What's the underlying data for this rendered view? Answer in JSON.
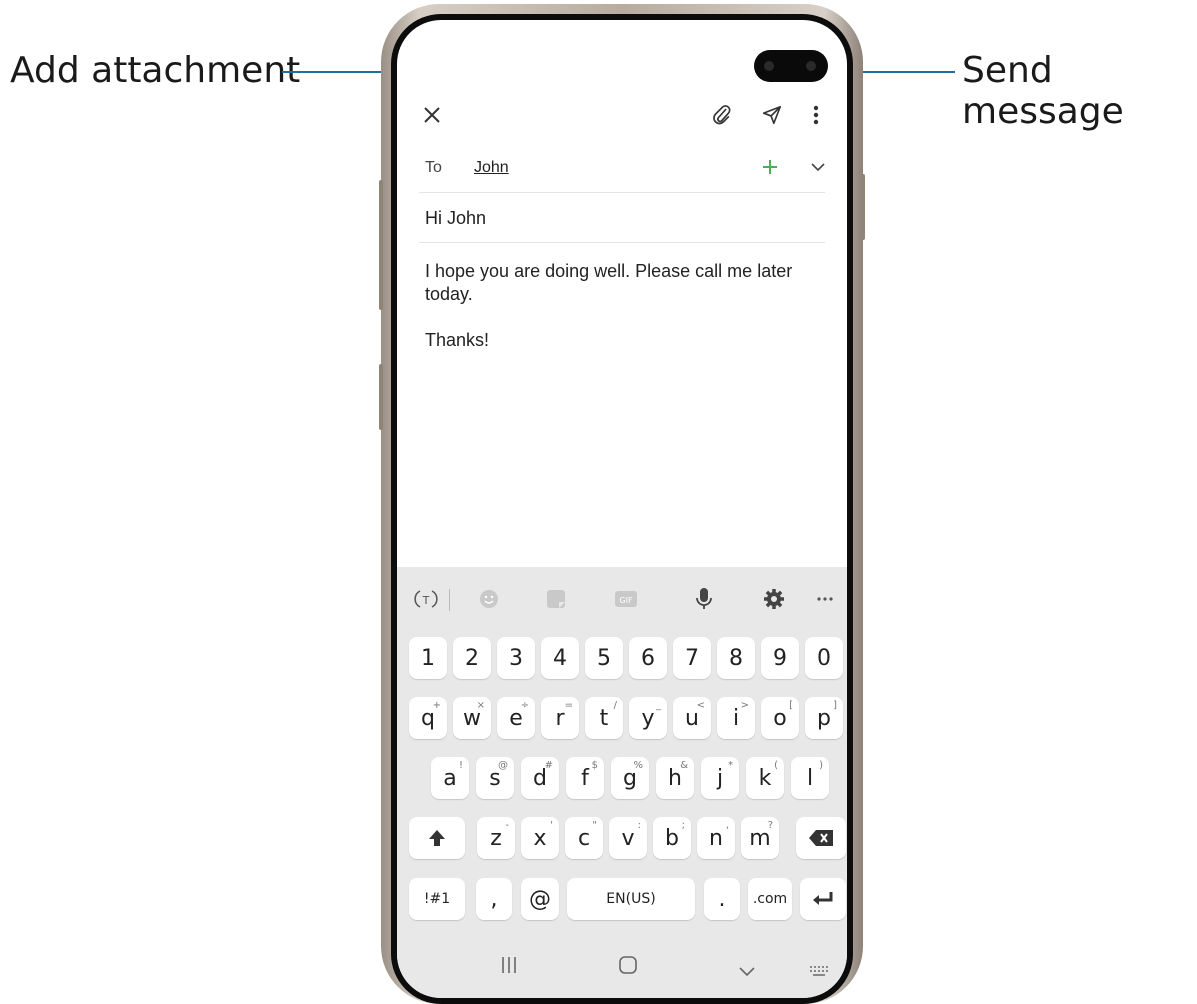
{
  "callouts": {
    "left_label": "Add attachment",
    "right_label": "Send message",
    "line_color": "#1f6fa0"
  },
  "app": {
    "to_label": "To",
    "recipient": "John",
    "subject": "Hi John",
    "body": "I hope you are doing well. Please call me later today.\n\nThanks!",
    "icons": {
      "close": "close-icon",
      "attach": "paperclip-icon",
      "send": "send-icon",
      "more": "more-vertical-icon",
      "add": "add-recipient-icon",
      "expand": "chevron-down-icon"
    },
    "add_color": "#4caf50"
  },
  "keyboard": {
    "toolbar": [
      "text-style-icon",
      "emoji-icon",
      "sticker-icon",
      "gif-icon",
      "microphone-icon",
      "settings-icon",
      "more-horizontal-icon"
    ],
    "numbers": [
      "1",
      "2",
      "3",
      "4",
      "5",
      "6",
      "7",
      "8",
      "9",
      "0"
    ],
    "row1": [
      {
        "k": "q",
        "s": "+"
      },
      {
        "k": "w",
        "s": "×"
      },
      {
        "k": "e",
        "s": "÷"
      },
      {
        "k": "r",
        "s": "="
      },
      {
        "k": "t",
        "s": "/"
      },
      {
        "k": "y",
        "s": "_"
      },
      {
        "k": "u",
        "s": "<"
      },
      {
        "k": "i",
        "s": ">"
      },
      {
        "k": "o",
        "s": "["
      },
      {
        "k": "p",
        "s": "]"
      }
    ],
    "row2": [
      {
        "k": "a",
        "s": "!"
      },
      {
        "k": "s",
        "s": "@"
      },
      {
        "k": "d",
        "s": "#"
      },
      {
        "k": "f",
        "s": "$"
      },
      {
        "k": "g",
        "s": "%"
      },
      {
        "k": "h",
        "s": "&"
      },
      {
        "k": "j",
        "s": "*"
      },
      {
        "k": "k",
        "s": "("
      },
      {
        "k": "l",
        "s": ")"
      }
    ],
    "row3": [
      {
        "k": "z",
        "s": "-"
      },
      {
        "k": "x",
        "s": "'"
      },
      {
        "k": "c",
        "s": "\""
      },
      {
        "k": "v",
        "s": ":"
      },
      {
        "k": "b",
        "s": ";"
      },
      {
        "k": "n",
        "s": ","
      },
      {
        "k": "m",
        "s": "?"
      }
    ],
    "sym_label": "!#1",
    "comma": ",",
    "at": "@",
    "space_label": "EN(US)",
    "period": ".",
    "dotcom": ".com",
    "shift": "shift-icon",
    "backspace": "backspace-icon",
    "enter": "enter-icon"
  },
  "navbar": [
    "recent-apps-icon",
    "home-icon",
    "back-icon",
    "keyboard-hide-icon"
  ]
}
